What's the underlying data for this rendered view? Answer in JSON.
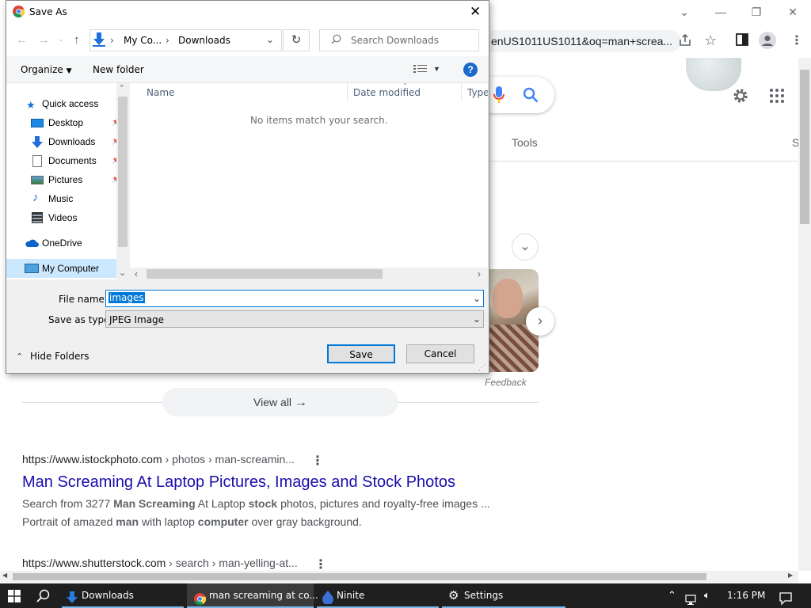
{
  "browser": {
    "url_fragment": "enUS1011US1011&oq=man+screa...",
    "tools_label": "Tools",
    "tab_partial": "S",
    "feedback": "Feedback",
    "view_all": "View all"
  },
  "results": [
    {
      "cite_domain": "https://www.istockphoto.com",
      "cite_path": " › photos › man-screamin...",
      "title": "Man Screaming At Laptop Pictures, Images and Stock Photos",
      "snippet_line1_parts": [
        "Search from 3277 ",
        "Man Screaming",
        " At Laptop ",
        "stock",
        " photos, pictures and royalty-free images ..."
      ],
      "snippet_line2_parts": [
        "Portrait of amazed ",
        "man",
        " with laptop ",
        "computer",
        " over gray background."
      ]
    },
    {
      "cite_domain": "https://www.shutterstock.com",
      "cite_path": " › search › man-yelling-at..."
    }
  ],
  "dialog": {
    "title": "Save As",
    "breadcrumb": [
      "My Co...",
      "Downloads"
    ],
    "search_placeholder": "Search Downloads",
    "organize": "Organize",
    "new_folder": "New folder",
    "help": "?",
    "columns": [
      "Name",
      "Date modified",
      "Type"
    ],
    "empty_message": "No items match your search.",
    "nav_items": [
      {
        "label": "Quick access"
      },
      {
        "label": "Desktop"
      },
      {
        "label": "Downloads"
      },
      {
        "label": "Documents"
      },
      {
        "label": "Pictures"
      },
      {
        "label": "Music"
      },
      {
        "label": "Videos"
      },
      {
        "label": "OneDrive"
      },
      {
        "label": "My Computer"
      }
    ],
    "file_name_label": "File name:",
    "file_name_value": "images",
    "save_type_label": "Save as type:",
    "save_type_value": "JPEG Image",
    "hide_folders": "Hide Folders",
    "save": "Save",
    "cancel": "Cancel"
  },
  "taskbar": {
    "items": [
      "Downloads",
      "man screaming at co...",
      "Ninite",
      "Settings"
    ],
    "time": "1:16 PM"
  },
  "colors": {
    "link": "#1a0dab",
    "selection": "#0078d7",
    "taskbar": "#1f1f1f"
  }
}
